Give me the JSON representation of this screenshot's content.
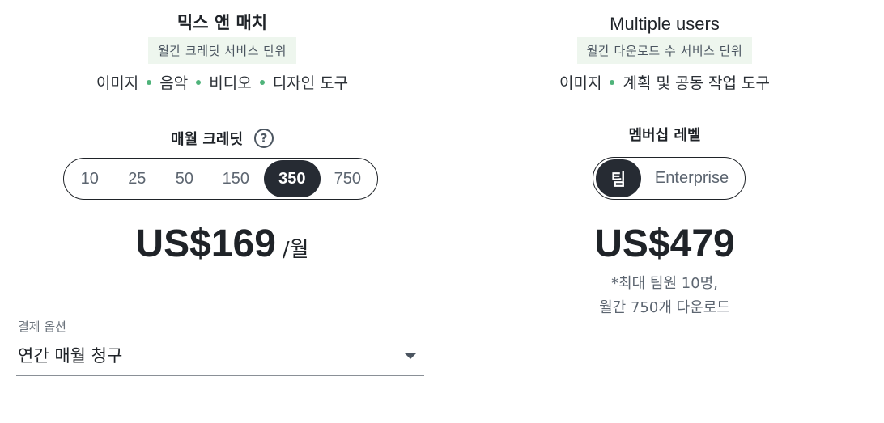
{
  "left": {
    "title": "믹스 앤 매치",
    "badge": "월간 크레딧 서비스 단위",
    "features": [
      "이미지",
      "음악",
      "비디오",
      "디자인 도구"
    ],
    "credits_label": "매월 크레딧",
    "help_icon": "?",
    "credit_options": [
      {
        "label": "10",
        "selected": false
      },
      {
        "label": "25",
        "selected": false
      },
      {
        "label": "50",
        "selected": false
      },
      {
        "label": "150",
        "selected": false
      },
      {
        "label": "350",
        "selected": true
      },
      {
        "label": "750",
        "selected": false
      }
    ],
    "price": "US$169",
    "per": "/월",
    "billing_label": "결제 옵션",
    "billing_value": "연간 매월 청구"
  },
  "right": {
    "title": "Multiple users",
    "badge": "월간 다운로드 수 서비스 단위",
    "features": [
      "이미지",
      "계획 및 공동 작업 도구"
    ],
    "membership_label": "멤버십 레벨",
    "membership_options": [
      {
        "label": "팀",
        "selected": true
      },
      {
        "label": "Enterprise",
        "selected": false
      }
    ],
    "price": "US$479",
    "note_line1": "*최대 팀원 10명,",
    "note_line2": "월간 750개 다운로드"
  },
  "colors": {
    "accent_dark": "#262b33",
    "feature_dot": "#4fb37a",
    "badge_bg": "#eef6ee"
  }
}
